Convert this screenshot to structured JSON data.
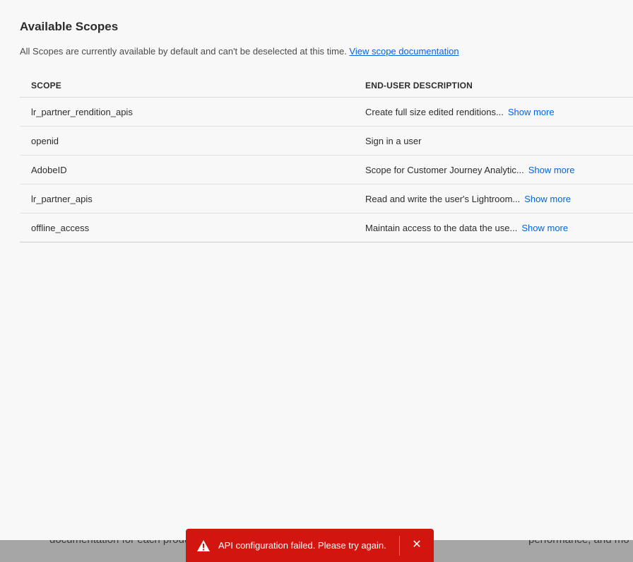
{
  "section": {
    "title": "Available Scopes",
    "subtitle": "All Scopes are currently available by default and can't be deselected at this time. ",
    "doc_link": "View scope documentation"
  },
  "table": {
    "headers": {
      "scope": "SCOPE",
      "description": "END-USER DESCRIPTION"
    },
    "rows": [
      {
        "scope": "lr_partner_rendition_apis",
        "description": "Create full size edited renditions...",
        "more": "Show more"
      },
      {
        "scope": "openid",
        "description": "Sign in a user",
        "more": ""
      },
      {
        "scope": "AdobeID",
        "description": "Scope for Customer Journey Analytic...",
        "more": "Show more"
      },
      {
        "scope": "lr_partner_apis",
        "description": "Read and write the user's Lightroom...",
        "more": "Show more"
      },
      {
        "scope": "offline_access",
        "description": "Maintain access to the data the use...",
        "more": "Show more"
      }
    ]
  },
  "background": {
    "left_text": "documentation for each produ",
    "right_text": "performance, and mo"
  },
  "toast": {
    "message": "API configuration failed. Please try again.",
    "close_glyph": "✕",
    "color": "#d31510"
  },
  "colors": {
    "link": "#0265dc",
    "background": "#f8f8f8"
  }
}
